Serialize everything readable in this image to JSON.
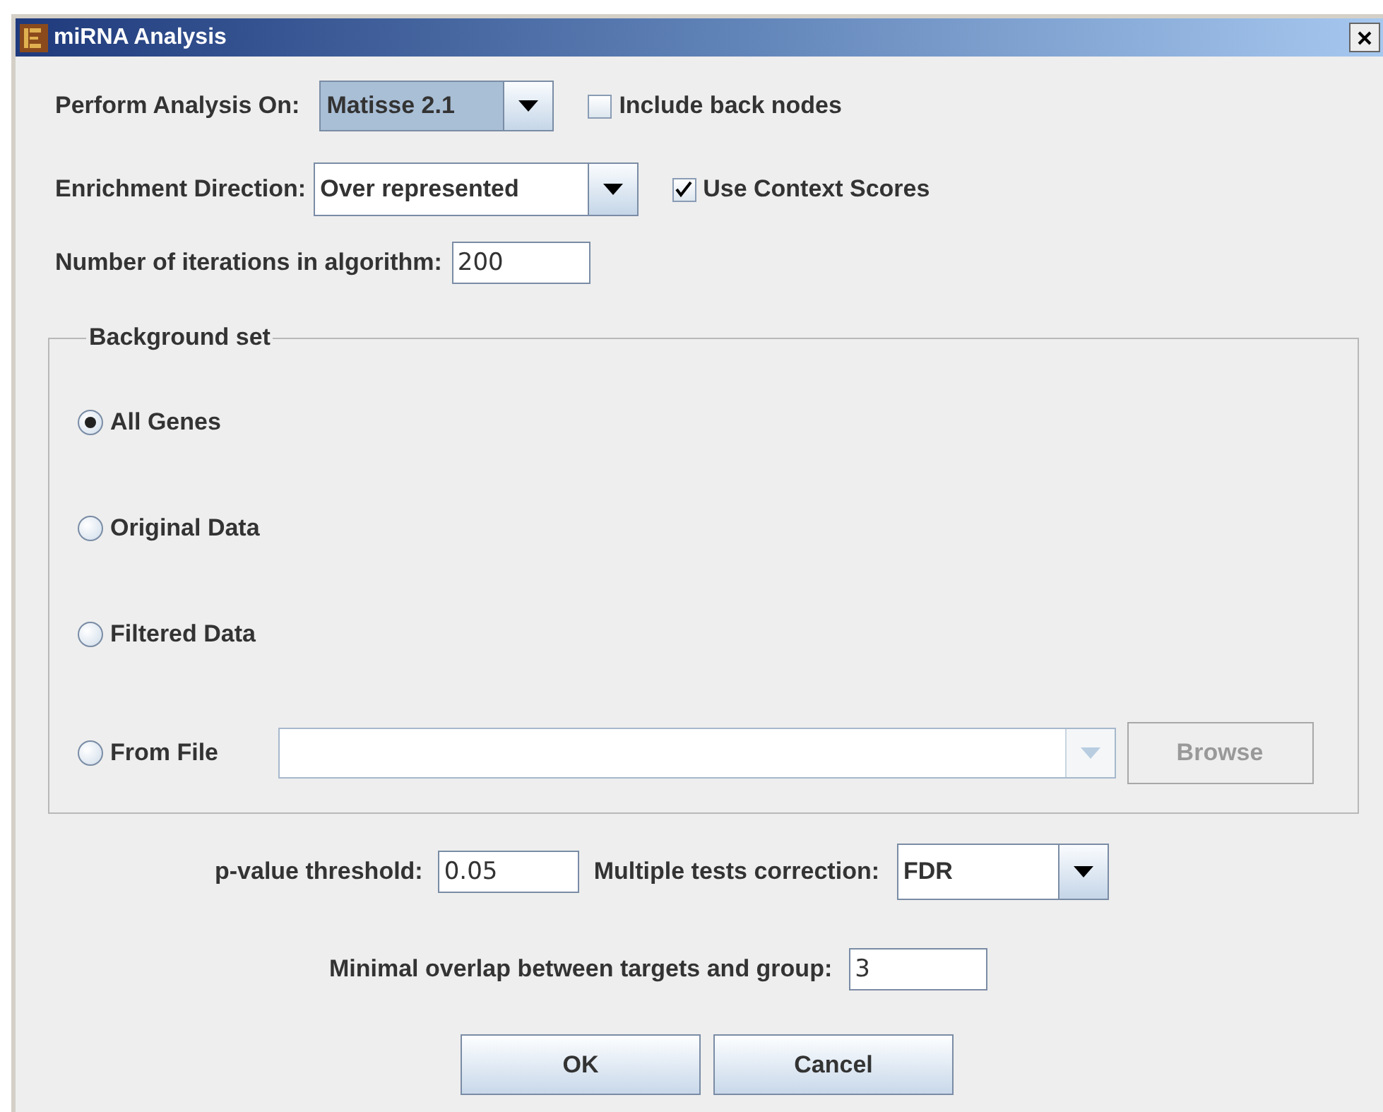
{
  "window": {
    "title": "miRNA Analysis"
  },
  "analysis_on": {
    "label": "Perform Analysis On:",
    "value": "Matisse 2.1",
    "focused": true
  },
  "include_back_nodes": {
    "label": "Include back nodes",
    "checked": false
  },
  "enrichment": {
    "label": "Enrichment Direction:",
    "value": "Over represented",
    "focused": false
  },
  "use_context_scores": {
    "label": "Use Context Scores",
    "checked": true
  },
  "iterations": {
    "label": "Number of iterations in algorithm:",
    "value": "200"
  },
  "background": {
    "title": "Background set",
    "options": [
      {
        "label": "All Genes",
        "selected": true
      },
      {
        "label": "Original Data",
        "selected": false
      },
      {
        "label": "Filtered Data",
        "selected": false
      },
      {
        "label": "From File",
        "selected": false
      }
    ],
    "file_combo": {
      "disabled": true
    },
    "browse": {
      "label": "Browse",
      "disabled": true
    }
  },
  "p_value": {
    "label": "p-value threshold:",
    "value": "0.05"
  },
  "correction": {
    "label": "Multiple tests correction:",
    "value": "FDR",
    "focused": false
  },
  "min_overlap": {
    "label": "Minimal overlap between targets and group:",
    "value": "3"
  },
  "buttons": [
    "OK",
    "Cancel"
  ]
}
